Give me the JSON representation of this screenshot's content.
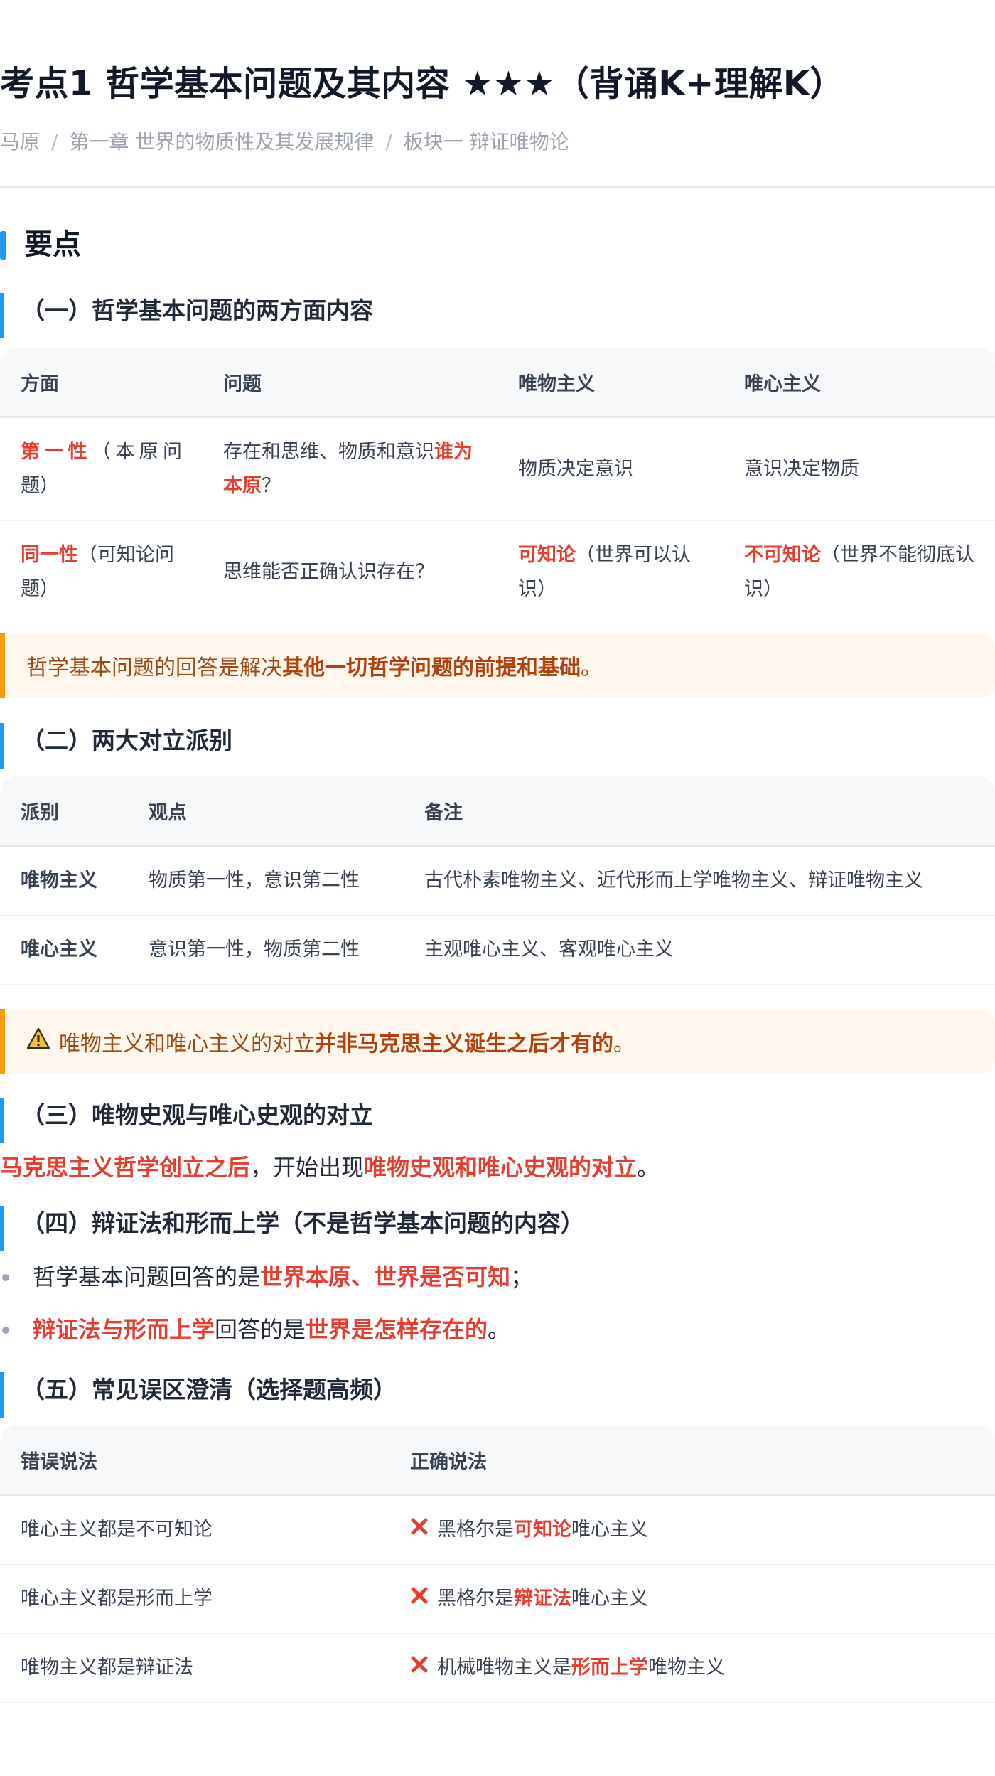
{
  "title": "考点1 哲学基本问题及其内容 ★★★（背诵K+理解K）",
  "breadcrumb": [
    "马原",
    "第一章 世界的物质性及其发展规律",
    "板块一 辩证唯物论"
  ],
  "section_title": "要点",
  "s1": {
    "heading": "（一）哲学基本问题的两方面内容",
    "headers": [
      "方面",
      "问题",
      "唯物主义",
      "唯心主义"
    ],
    "row1": {
      "aspect_red": "第一性",
      "aspect_rest": "（本原问题）",
      "question_pre": "存在和思维、物质和意识",
      "question_red": "谁为本原",
      "question_post": "？",
      "materialism": "物质决定意识",
      "idealism": "意识决定物质"
    },
    "row2": {
      "aspect_red": "同一性",
      "aspect_rest": "（可知论问题）",
      "question": "思维能否正确认识存在？",
      "materialism_red": "可知论",
      "materialism_rest": "（世界可以认识）",
      "idealism_red": "不可知论",
      "idealism_rest": "（世界不能彻底认识）"
    },
    "note_pre": "哲学基本问题的回答是解决",
    "note_bold": "其他一切哲学问题的前提和基础",
    "note_post": "。"
  },
  "s2": {
    "heading": "（二）两大对立派别",
    "headers": [
      "派别",
      "观点",
      "备注"
    ],
    "rows": [
      {
        "school": "唯物主义",
        "view": "物质第一性，意识第二性",
        "remark": "古代朴素唯物主义、近代形而上学唯物主义、辩证唯物主义"
      },
      {
        "school": "唯心主义",
        "view": "意识第一性，物质第二性",
        "remark": "主观唯心主义、客观唯心主义"
      }
    ],
    "note_pre": "唯物主义和唯心主义的对立",
    "note_bold": "并非马克思主义诞生之后才有的",
    "note_post": "。"
  },
  "s3": {
    "heading": "（三）唯物史观与唯心史观的对立",
    "red1": "马克思主义哲学创立之后",
    "mid": "，开始出现",
    "red2": "唯物史观和唯心史观的对立",
    "end": "。"
  },
  "s4": {
    "heading": "（四）辩证法和形而上学（不是哲学基本问题的内容）",
    "b1_pre": "哲学基本问题回答的是",
    "b1_red": "世界本原、世界是否可知",
    "b1_post": "；",
    "b2_red1": "辩证法与形而上学",
    "b2_mid": "回答的是",
    "b2_red2": "世界是怎样存在的",
    "b2_post": "。"
  },
  "s5": {
    "heading": "（五）常见误区澄清（选择题高频）",
    "headers": [
      "错误说法",
      "正确说法"
    ],
    "rows": [
      {
        "wrong": "唯心主义都是不可知论",
        "pre": "黑格尔是",
        "red": "可知论",
        "post": "唯心主义"
      },
      {
        "wrong": "唯心主义都是形而上学",
        "pre": "黑格尔是",
        "red": "辩证法",
        "post": "唯心主义"
      },
      {
        "wrong": "唯物主义都是辩证法",
        "pre": "机械唯物主义是",
        "red": "形而上学",
        "post": "唯物主义"
      }
    ]
  },
  "colors": {
    "accent": "#1e9bf0",
    "highlight": "#e53e2e",
    "note_bg": "#fff7ed",
    "note_border": "#f59e0b"
  },
  "icons": [
    "warning-icon",
    "cross-icon"
  ]
}
